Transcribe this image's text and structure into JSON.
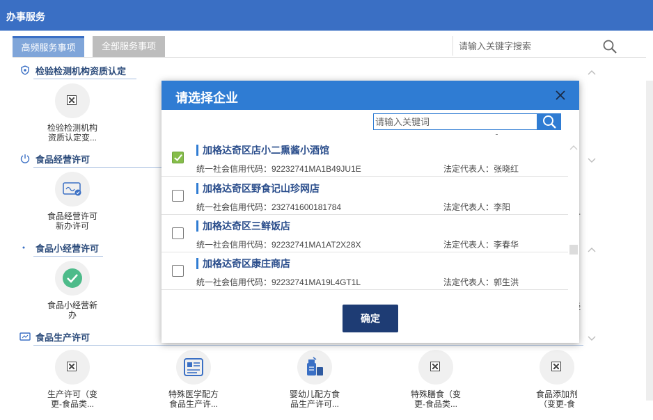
{
  "header": {
    "title": "办事服务"
  },
  "tabs": [
    {
      "label": "高频服务事项",
      "active": true
    },
    {
      "label": "全部服务事项",
      "active": false
    }
  ],
  "search": {
    "placeholder": "请输入关键字搜索"
  },
  "sections": [
    {
      "title": "检验检测机构资质认定",
      "tiles": [
        {
          "label_lines": [
            "检验检测机构",
            "资质认定变..."
          ]
        }
      ]
    },
    {
      "title": "食品经营许可",
      "tiles": [
        {
          "label_lines": [
            "食品经营许可",
            "新办许可"
          ]
        }
      ],
      "clipped_right": "可"
    },
    {
      "title": "食品小经营许可",
      "tiles": [
        {
          "label_lines": [
            "食品小经营新",
            "办"
          ]
        }
      ],
      "clipped_right": "经"
    },
    {
      "title": "食品生产许可",
      "tiles": [
        {
          "label_lines": [
            "生产许可（变",
            "更-食品类..."
          ]
        },
        {
          "label_lines": [
            "特殊医学配方",
            "食品生产许..."
          ]
        },
        {
          "label_lines": [
            "婴幼儿配方食",
            "品生产许可..."
          ]
        },
        {
          "label_lines": [
            "特殊膳食（变",
            "更-食品类..."
          ]
        },
        {
          "label_lines": [
            "食品添加剂",
            "（变更-食"
          ]
        }
      ]
    }
  ],
  "modal": {
    "title": "请选择企业",
    "search_placeholder": "请输入关键词",
    "confirm_label": "确定",
    "enterprises": [
      {
        "name": "加格达奇区店小二熏酱小酒馆",
        "credit_code": "统一社会信用代码：92232741MA1B49JU1E",
        "legal_rep": "法定代表人：张晓红",
        "checked": true
      },
      {
        "name": "加格达奇区野食记山珍网店",
        "credit_code": "统一社会信用代码：232741600181784",
        "legal_rep": "法定代表人：李阳",
        "checked": false
      },
      {
        "name": "加格达奇区三鲜饭店",
        "credit_code": "统一社会信用代码：92232741MA1AT2X28X",
        "legal_rep": "法定代表人：李春华",
        "checked": false
      },
      {
        "name": "加格达奇区康庄商店",
        "credit_code": "统一社会信用代码：92232741MA19L4GT1L",
        "legal_rep": "法定代表人：郭生洪",
        "checked": false
      }
    ]
  },
  "colors": {
    "header_bg": "#3a6fc4",
    "modal_header_bg": "#2f7cd3",
    "confirm_bg": "#1e3c74",
    "check_green": "#86bd4a",
    "title_blue": "#2b4e8c"
  }
}
